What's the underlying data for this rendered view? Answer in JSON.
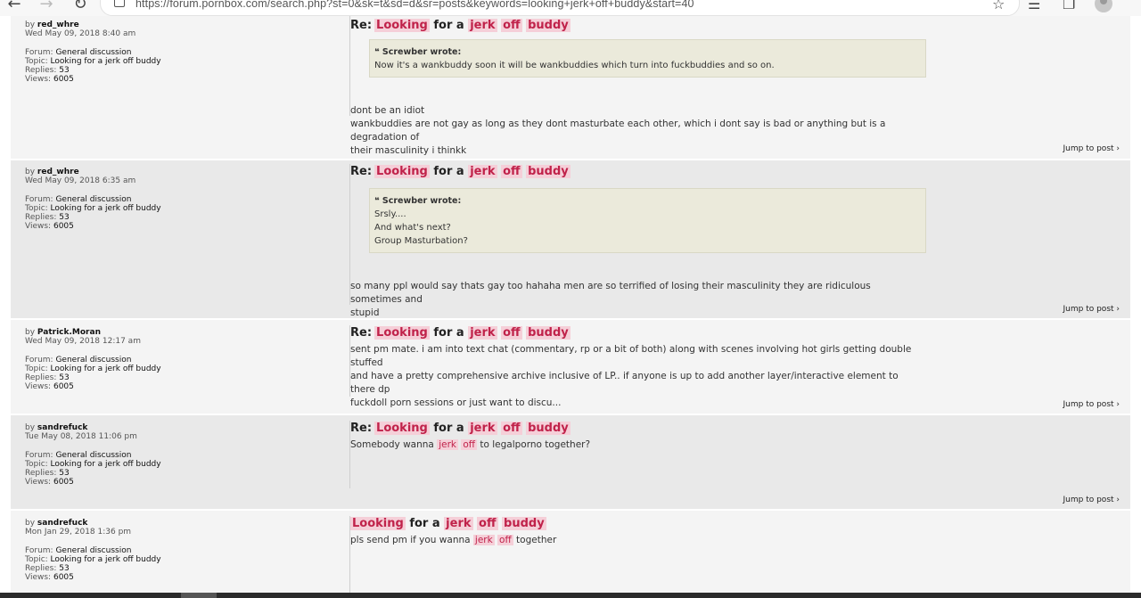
{
  "browser": {
    "url": "https://forum.pornbox.com/search.php?st=0&sk=t&sd=d&sr=posts&keywords=looking+jerk+off+buddy&start=40"
  },
  "labels": {
    "by": "by",
    "forum": "Forum:",
    "topic": "Topic:",
    "replies": "Replies:",
    "views": "Views:",
    "jump": "Jump to post ›",
    "re": "Re:",
    "for_a": "for a",
    "wrote": "wrote:"
  },
  "title_words": {
    "looking": "Looking",
    "jerk": "jerk",
    "off": "off",
    "buddy": "buddy"
  },
  "posts": [
    {
      "author": "red_whre",
      "date": "Wed May 09, 2018 8:40 am",
      "forum": "General discussion",
      "topic": "Looking for a jerk off buddy",
      "replies": "53",
      "views": "6005",
      "quote_author": "Screwber",
      "quote_lines": [
        "Now it's a wankbuddy soon it will be wankbuddies which turn into fuckbuddies and so on."
      ],
      "lines": [
        "dont be an idiot",
        "wankbuddies are not gay as long as they dont masturbate each other, which i dont say is bad or anything but is a degradation of",
        "their masculinity i thinkk"
      ]
    },
    {
      "author": "red_whre",
      "date": "Wed May 09, 2018 6:35 am",
      "forum": "General discussion",
      "topic": "Looking for a jerk off buddy",
      "replies": "53",
      "views": "6005",
      "quote_author": "Screwber",
      "quote_lines": [
        "Srsly....",
        "And what's next?",
        "Group Masturbation?"
      ],
      "lines": [
        "so many ppl would say thats gay too hahaha men are so terrified of losing their masculinity they are ridiculous sometimes and",
        "stupid"
      ]
    },
    {
      "author": "Patrick.Moran",
      "date": "Wed May 09, 2018 12:17 am",
      "forum": "General discussion",
      "topic": "Looking for a jerk off buddy",
      "replies": "53",
      "views": "6005",
      "lines": [
        "sent pm mate. i am into text chat (commentary, rp or a bit of both) along with scenes involving hot girls getting double stuffed",
        "and have a pretty comprehensive archive inclusive of LP.. if anyone is up to add another layer/interactive element to there dp",
        "fuckdoll porn sessions or just want to discu..."
      ]
    },
    {
      "author": "sandrefuck",
      "date": "Tue May 08, 2018 11:06 pm",
      "forum": "General discussion",
      "topic": "Looking for a jerk off buddy",
      "replies": "53",
      "views": "6005",
      "content_before": "Somebody wanna",
      "content_hl1": "jerk",
      "content_hl2": "off",
      "content_after": "to legalporno together?"
    },
    {
      "author": "sandrefuck",
      "date": "Mon Jan 29, 2018 1:36 pm",
      "forum": "General discussion",
      "topic": "Looking for a jerk off buddy",
      "replies": "53",
      "views": "6005",
      "content_before": "pls send pm if you wanna",
      "content_hl1": "jerk",
      "content_hl2": "off",
      "content_after": "together"
    }
  ]
}
